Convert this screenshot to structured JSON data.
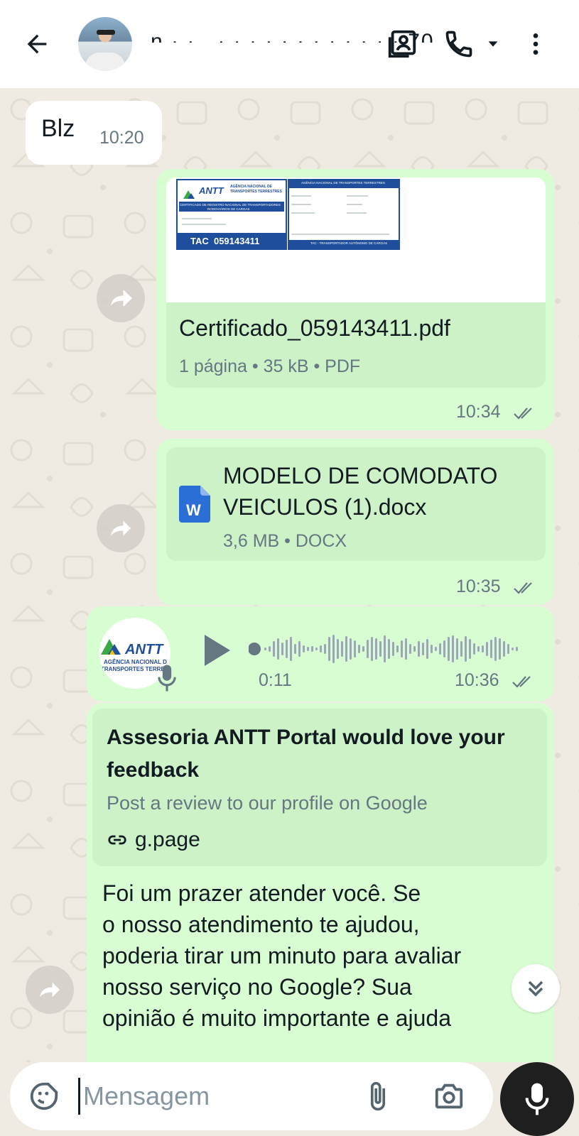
{
  "header": {
    "contact_name": "n  ·   ·  .  ·  ·  ·   ·  ·  ·   ·  ·  ·   ·  ·   ·  70"
  },
  "messages": [
    {
      "type": "text",
      "direction": "incoming",
      "text": "Blz",
      "time": "10:20"
    },
    {
      "type": "document",
      "direction": "outgoing",
      "preview": {
        "logo_text": "ANTT",
        "agency_line1": "AGÊNCIA NACIONAL DE",
        "agency_line2": "TRANSPORTES TERRESTRES",
        "cert_line1": "CERTIFICADO DE REGISTRO NACIONAL DE TRANSPORTADORES",
        "cert_line2": "RODOVIÁRIOS DE CARGAS",
        "tac": "TAC  059143411",
        "right_title": "AGÊNCIA NACIONAL DE TRANSPORTES TERRESTRES",
        "right_footer": "TAC - TRANSPORTADOR AUTÔNOMO DE CARGAS"
      },
      "file_name": "Certificado_059143411.pdf",
      "file_info": "1 página • 35 kB • PDF",
      "time": "10:34"
    },
    {
      "type": "document",
      "direction": "outgoing",
      "file_icon_letter": "W",
      "file_name_line1": "MODELO DE COMODATO",
      "file_name_line2": "VEICULOS (1).docx",
      "file_info": "3,6 MB • DOCX",
      "time": "10:35"
    },
    {
      "type": "voice",
      "direction": "outgoing",
      "avatar_logo": "ANTT",
      "avatar_line1": "AGÊNCIA NACIONAL D",
      "avatar_line2": "TRANSPORTES TERREST",
      "duration": "0:11",
      "time": "10:36",
      "progress": 0
    },
    {
      "type": "link",
      "direction": "outgoing",
      "card_title": "Assesoria ANTT Portal would love your feedback",
      "card_desc": "Post a review to our profile on Google",
      "card_link": "g.page",
      "body_line1": "Foi um prazer atender você. Se",
      "body_line2": "o nosso atendimento te ajudou,",
      "body_line3": "poderia tirar um minuto para avaliar",
      "body_line4": "nosso serviço no Google? Sua",
      "body_line5": "opinião é muito importante e ajuda"
    }
  ],
  "composer": {
    "placeholder": "Mensagem"
  },
  "colors": {
    "outgoing_bubble": "#d9fdd3",
    "incoming_bubble": "#ffffff",
    "chat_background": "#efeae2",
    "tick_color": "#667781",
    "docx_blue": "#2b6fd6",
    "antt_blue": "#1f4e9c",
    "antt_green": "#3aa845"
  },
  "icons": [
    "back-arrow-icon",
    "contact-card-icon",
    "phone-icon",
    "dropdown-arrow-icon",
    "more-vert-icon",
    "forward-icon",
    "word-doc-icon",
    "play-icon",
    "mic-icon",
    "link-icon",
    "double-chevron-down-icon",
    "sticker-icon",
    "attach-icon",
    "camera-icon"
  ]
}
